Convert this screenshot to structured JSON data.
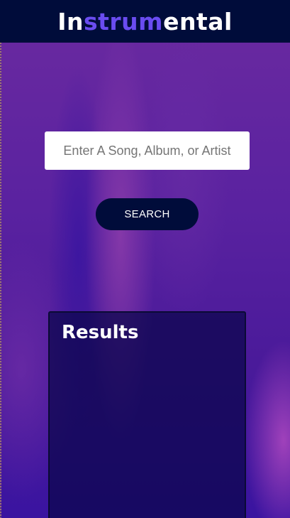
{
  "header": {
    "logo_parts": [
      "In",
      "strum",
      "ental"
    ],
    "colors": {
      "background": "#000c3a",
      "text": "#ffffff",
      "accent": "#6a4cf0"
    }
  },
  "search": {
    "placeholder": "Enter A Song, Album, or Artist",
    "value": "",
    "button_label": "SEARCH"
  },
  "results": {
    "title": "Results",
    "items": []
  }
}
